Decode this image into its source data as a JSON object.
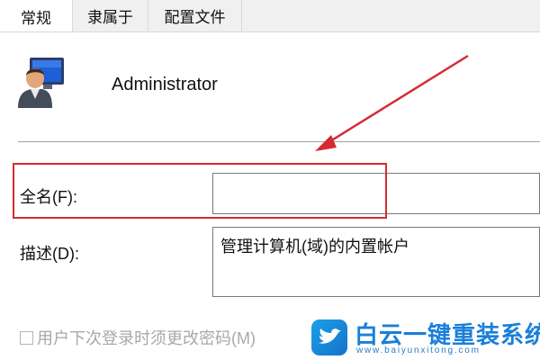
{
  "tabs": [
    {
      "label": "常规",
      "active": true
    },
    {
      "label": "隶属于",
      "active": false
    },
    {
      "label": "配置文件",
      "active": false
    }
  ],
  "user": {
    "name": "Administrator",
    "icon": "user-avatar-icon"
  },
  "fields": {
    "fullname_label": "全名(F):",
    "fullname_value": "",
    "description_label": "描述(D):",
    "description_value": "管理计算机(域)的内置帐户"
  },
  "checkbox": {
    "label": "用户下次登录时须更改密码(M)",
    "checked": false,
    "enabled": false
  },
  "watermark": {
    "title": "白云一键重装系统",
    "url": "www.baiyunxitong.com",
    "icon": "bird-logo-icon"
  },
  "colors": {
    "highlight": "#d42b33",
    "arrow": "#d42b33",
    "watermark": "#1a7fd9"
  }
}
